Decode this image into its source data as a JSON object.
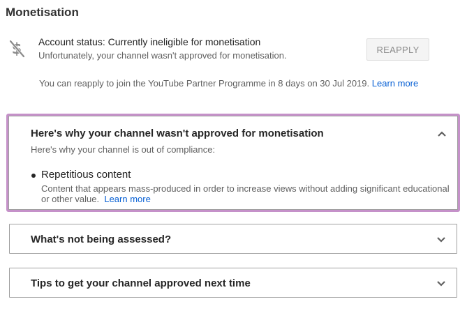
{
  "page": {
    "title": "Monetisation"
  },
  "status": {
    "icon": "no-money-icon",
    "heading": "Account status: Currently ineligible for monetisation",
    "subtext": "Unfortunately, your channel wasn't approved for monetisation.",
    "reapply_label": "REAPPLY",
    "reapply_note": "You can reapply to join the YouTube Partner Programme in 8 days on 30 Jul 2019.",
    "reapply_link": "Learn more"
  },
  "panels": {
    "not_approved": {
      "title": "Here's why your channel wasn't approved for monetisation",
      "description": "Here's why your channel is out of compliance:",
      "expanded": true,
      "reason": {
        "title": "Repetitious content",
        "description": "Content that appears mass-produced in order to increase views without adding significant educational or other value.",
        "link": "Learn more"
      }
    },
    "not_assessed": {
      "title": "What's not being assessed?",
      "expanded": false
    },
    "tips": {
      "title": "Tips to get your channel approved next time",
      "expanded": false
    }
  },
  "colors": {
    "link": "#065fd4",
    "focus_outline": "#c591c9",
    "button_bg": "#f4f4f4",
    "button_text": "#8c8c8c"
  }
}
